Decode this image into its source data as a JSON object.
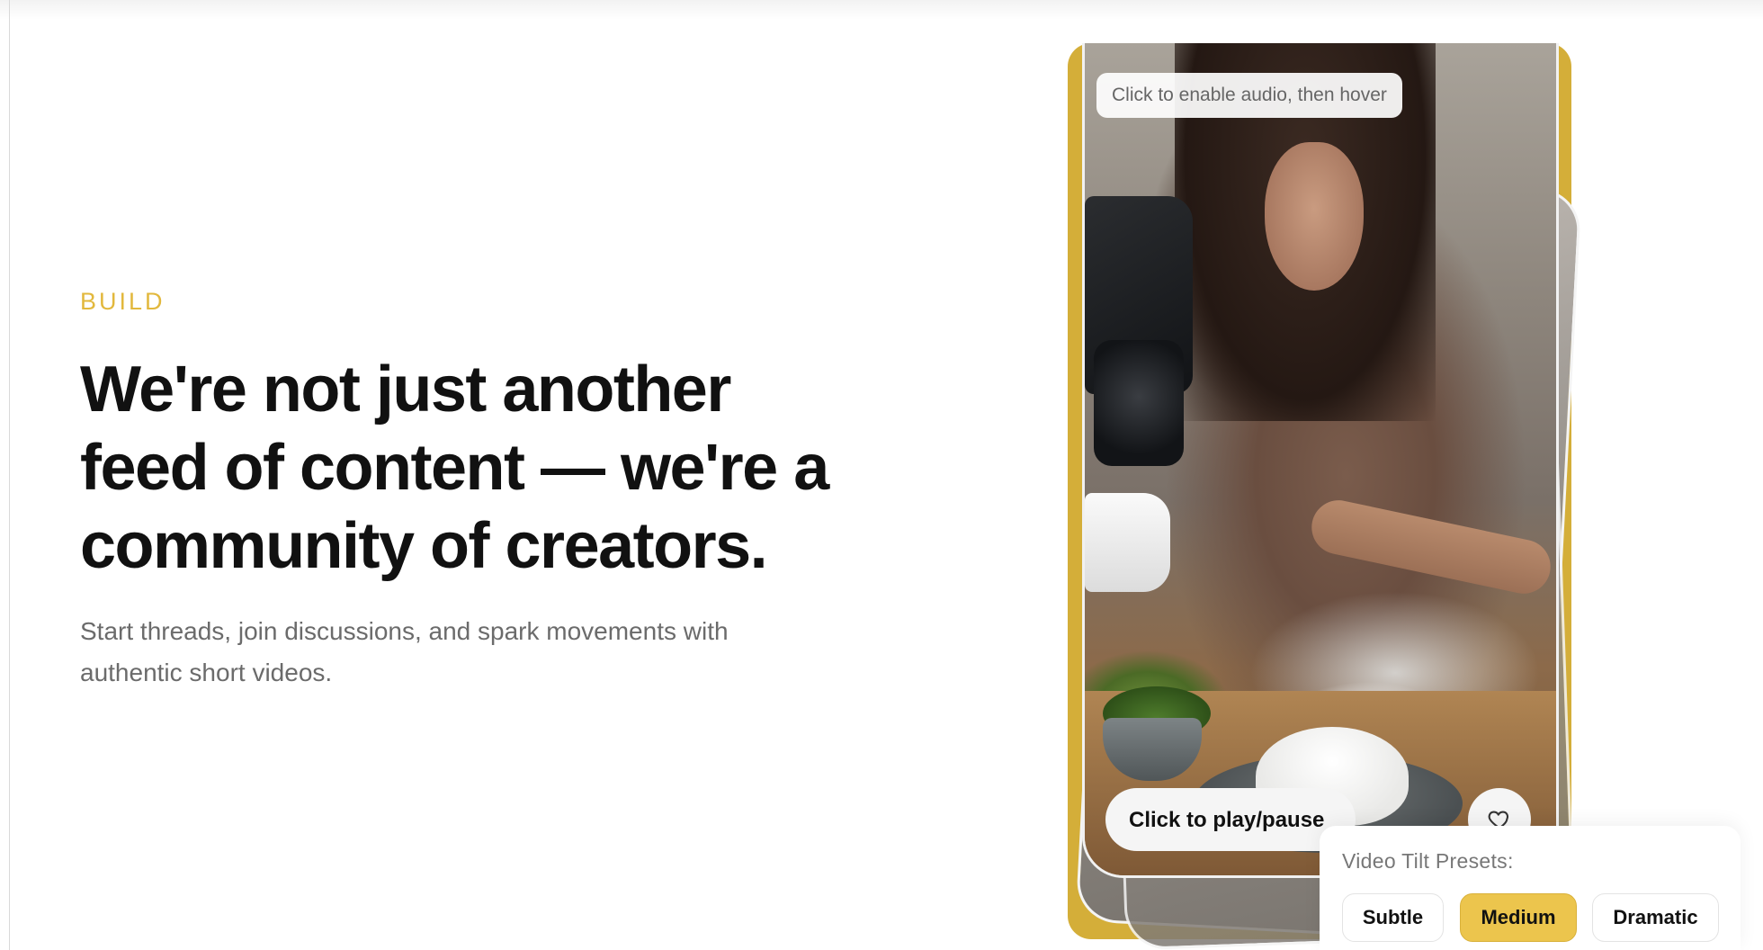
{
  "hero": {
    "eyebrow": "BUILD",
    "headline": "We're not just another feed of content — we're a community of creators.",
    "subtext": "Start threads, join discussions, and spark movements with authentic short videos."
  },
  "video": {
    "audio_hint": "Click to enable audio, then hover",
    "play_pause_label": "Click to play/pause",
    "like_icon": "heart-icon"
  },
  "presets": {
    "title": "Video Tilt Presets:",
    "options": [
      "Subtle",
      "Medium",
      "Dramatic"
    ],
    "selected": "Medium"
  },
  "colors": {
    "accent": "#e2b83d",
    "frame": "#d4ae39",
    "active_button": "#ecc54d"
  }
}
